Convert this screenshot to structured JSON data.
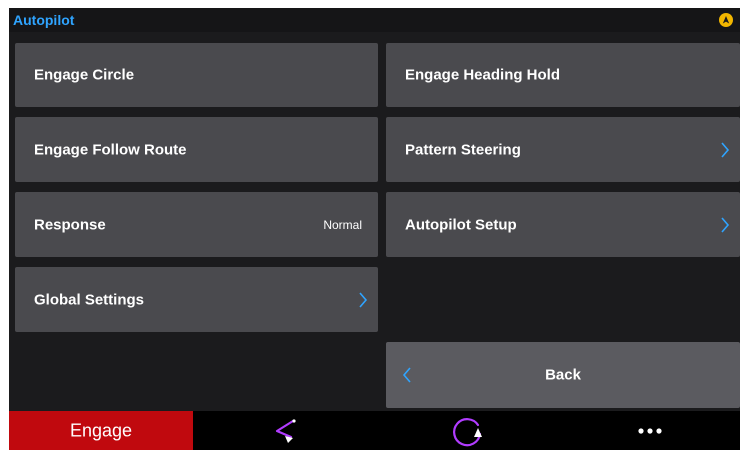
{
  "header": {
    "title": "Autopilot",
    "status_icon": "autopilot-status-icon",
    "status_color": "#f2b600"
  },
  "tiles": {
    "engage_circle": {
      "label": "Engage Circle"
    },
    "engage_heading_hold": {
      "label": "Engage Heading Hold"
    },
    "engage_follow_route": {
      "label": "Engage Follow Route"
    },
    "pattern_steering": {
      "label": "Pattern Steering",
      "icon": "chevron-right-icon"
    },
    "response": {
      "label": "Response",
      "value": "Normal"
    },
    "autopilot_setup": {
      "label": "Autopilot Setup",
      "icon": "chevron-right-icon"
    },
    "global_settings": {
      "label": "Global Settings",
      "icon": "chevron-right-icon"
    },
    "back": {
      "label": "Back",
      "icon": "chevron-left-icon"
    }
  },
  "bottom_bar": {
    "engage_label": "Engage",
    "engage_color": "#c0090e",
    "buttons": [
      {
        "icon": "pattern-steer-icon"
      },
      {
        "icon": "circle-turn-icon"
      },
      {
        "icon": "more-icon"
      }
    ]
  },
  "colors": {
    "accent": "#2fa4ff",
    "tile": "#4a4a4e",
    "background": "#1b1b1d",
    "icon_purple": "#b13cff"
  }
}
